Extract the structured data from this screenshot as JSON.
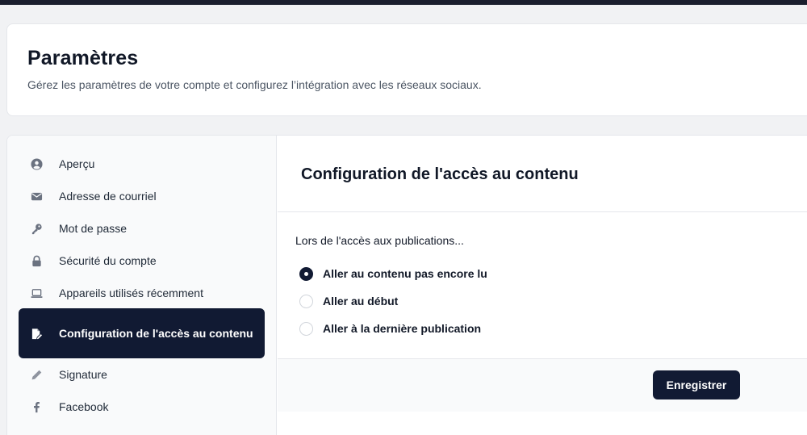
{
  "header": {
    "title": "Paramètres",
    "subtitle": "Gérez les paramètres de votre compte et configurez l’intégration avec les réseaux sociaux."
  },
  "sidebar": {
    "items": [
      {
        "label": "Aperçu",
        "icon": "user-circle-icon"
      },
      {
        "label": "Adresse de courriel",
        "icon": "envelope-icon"
      },
      {
        "label": "Mot de passe",
        "icon": "key-icon"
      },
      {
        "label": "Sécurité du compte",
        "icon": "lock-icon"
      },
      {
        "label": "Appareils utilisés récemment",
        "icon": "laptop-icon"
      },
      {
        "label": "Configuration de l'accès au contenu",
        "icon": "document-edit-icon",
        "active": true
      },
      {
        "label": "Signature",
        "icon": "pencil-icon"
      },
      {
        "label": "Facebook",
        "icon": "facebook-icon"
      }
    ]
  },
  "content": {
    "title": "Configuration de l'accès au contenu",
    "question": "Lors de l'accès aux publications...",
    "options": [
      {
        "label": "Aller au contenu pas encore lu",
        "checked": true
      },
      {
        "label": "Aller au début",
        "checked": false
      },
      {
        "label": "Aller à la dernière publication",
        "checked": false
      }
    ],
    "save_label": "Enregistrer"
  },
  "colors": {
    "accent": "#111a33",
    "topbar": "#1b1f2e",
    "page_background": "#f1f2f4"
  }
}
